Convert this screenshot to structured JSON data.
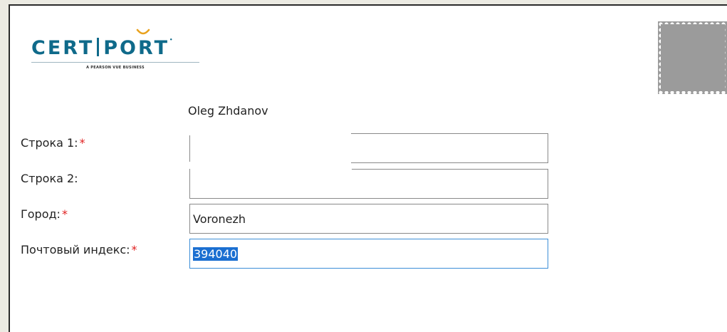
{
  "logo": {
    "wordmark_left": "CERT",
    "wordmark_right": "PORT",
    "tagline": "A PEARSON VUE BUSINESS"
  },
  "recipient": {
    "name": "Oleg Zhdanov"
  },
  "form": {
    "line1": {
      "label": "Строка 1:",
      "required_mark": "*",
      "value": ""
    },
    "line2": {
      "label": "Строка 2:",
      "value": ""
    },
    "city": {
      "label": "Город:",
      "required_mark": "*",
      "value": "Voronezh"
    },
    "postal": {
      "label": "Почтовый индекс:",
      "required_mark": "*",
      "value": "394040"
    }
  },
  "icons": {
    "stamp": "postage-stamp-icon"
  },
  "colors": {
    "brand": "#0f6a8a",
    "required": "#e02020",
    "selection": "#1b6fd1",
    "focus_border": "#3c8ed8",
    "stamp": "#9b9b9b"
  }
}
